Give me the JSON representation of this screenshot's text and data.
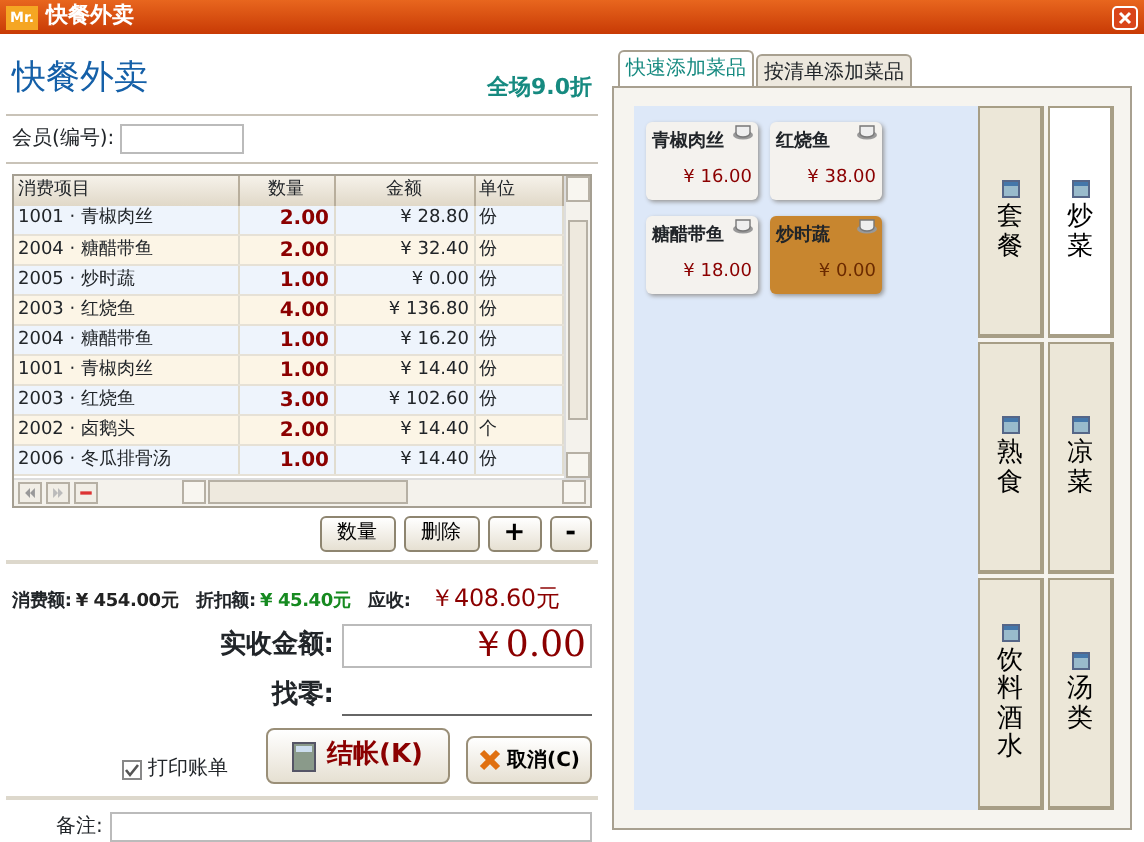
{
  "window": {
    "logo": "Mr.",
    "title": "快餐外卖"
  },
  "header": {
    "title": "快餐外卖",
    "discount": "全场9.0折"
  },
  "member": {
    "label": "会员(编号):"
  },
  "table": {
    "columns": [
      "消费项目",
      "数量",
      "金额",
      "单位"
    ],
    "rows": [
      {
        "item": "1001 · 青椒肉丝",
        "qty": "2.00",
        "amount": "¥ 28.80",
        "unit": "份"
      },
      {
        "item": "2004 · 糖醋带鱼",
        "qty": "2.00",
        "amount": "¥ 32.40",
        "unit": "份"
      },
      {
        "item": "2005 · 炒时蔬",
        "qty": "1.00",
        "amount": "¥ 0.00",
        "unit": "份"
      },
      {
        "item": "2003 · 红烧鱼",
        "qty": "4.00",
        "amount": "¥ 136.80",
        "unit": "份"
      },
      {
        "item": "2004 · 糖醋带鱼",
        "qty": "1.00",
        "amount": "¥ 16.20",
        "unit": "份"
      },
      {
        "item": "1001 · 青椒肉丝",
        "qty": "1.00",
        "amount": "¥ 14.40",
        "unit": "份"
      },
      {
        "item": "2003 · 红烧鱼",
        "qty": "3.00",
        "amount": "¥ 102.60",
        "unit": "份"
      },
      {
        "item": "2002 · 卤鹅头",
        "qty": "2.00",
        "amount": "¥ 14.40",
        "unit": "个"
      },
      {
        "item": "2006 · 冬瓜排骨汤",
        "qty": "1.00",
        "amount": "¥ 14.40",
        "unit": "份"
      }
    ]
  },
  "table_buttons": [
    "数量",
    "删除",
    "+",
    "-"
  ],
  "totals": [
    {
      "label": "消费额:",
      "value": "¥ 454.00元",
      "kind": "plain"
    },
    {
      "label": "折扣额:",
      "value": "¥ 45.40元",
      "kind": "discount"
    },
    {
      "label": "应收:",
      "value": "￥408.60元",
      "kind": "due"
    }
  ],
  "received": {
    "label": "实收金额:",
    "value": "￥0.00"
  },
  "change": {
    "label": "找零:"
  },
  "print_receipt": {
    "label": "打印账单",
    "checked": true
  },
  "checkout_button": "结帐(K)",
  "cancel_button": "取消(C)",
  "remark": {
    "label": "备注:"
  },
  "tabs": [
    {
      "label": "快速添加菜品",
      "selected": true
    },
    {
      "label": "按清单添加菜品",
      "selected": false
    }
  ],
  "dishes": [
    {
      "name": "青椒肉丝",
      "price": "¥ 16.00",
      "selected": false
    },
    {
      "name": "红烧鱼",
      "price": "¥ 38.00",
      "selected": false
    },
    {
      "name": "糖醋带鱼",
      "price": "¥ 18.00",
      "selected": false
    },
    {
      "name": "炒时蔬",
      "price": "¥ 0.00",
      "selected": true
    }
  ],
  "categories": [
    {
      "label": "套餐",
      "selected": false
    },
    {
      "label": "炒菜",
      "selected": true
    },
    {
      "label": "熟食",
      "selected": false
    },
    {
      "label": "凉菜",
      "selected": false
    },
    {
      "label": "饮料酒水",
      "selected": false
    },
    {
      "label": "汤类",
      "selected": false
    }
  ]
}
